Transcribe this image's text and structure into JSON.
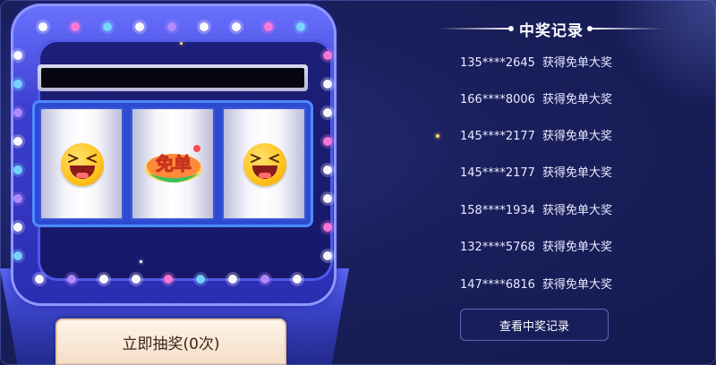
{
  "machine": {
    "reels": [
      "laughing-emoji",
      "free-order-logo",
      "laughing-emoji"
    ],
    "free_logo_text": "免单",
    "draw_button_label": "立即抽奖(0次)"
  },
  "records": {
    "title": "中奖记录",
    "items": [
      {
        "phone": "135****2645",
        "prize": "获得免单大奖"
      },
      {
        "phone": "166****8006",
        "prize": "获得免单大奖"
      },
      {
        "phone": "145****2177",
        "prize": "获得免单大奖"
      },
      {
        "phone": "145****2177",
        "prize": "获得免单大奖"
      },
      {
        "phone": "158****1934",
        "prize": "获得免单大奖"
      },
      {
        "phone": "132****5768",
        "prize": "获得免单大奖"
      },
      {
        "phone": "147****6816",
        "prize": "获得免单大奖"
      }
    ],
    "view_button_label": "查看中奖记录"
  },
  "colors": {
    "background": "#141a4e",
    "cabinet": "#3b3fd0",
    "button": "#f3dcc6",
    "emoji": "#ffc21e"
  }
}
